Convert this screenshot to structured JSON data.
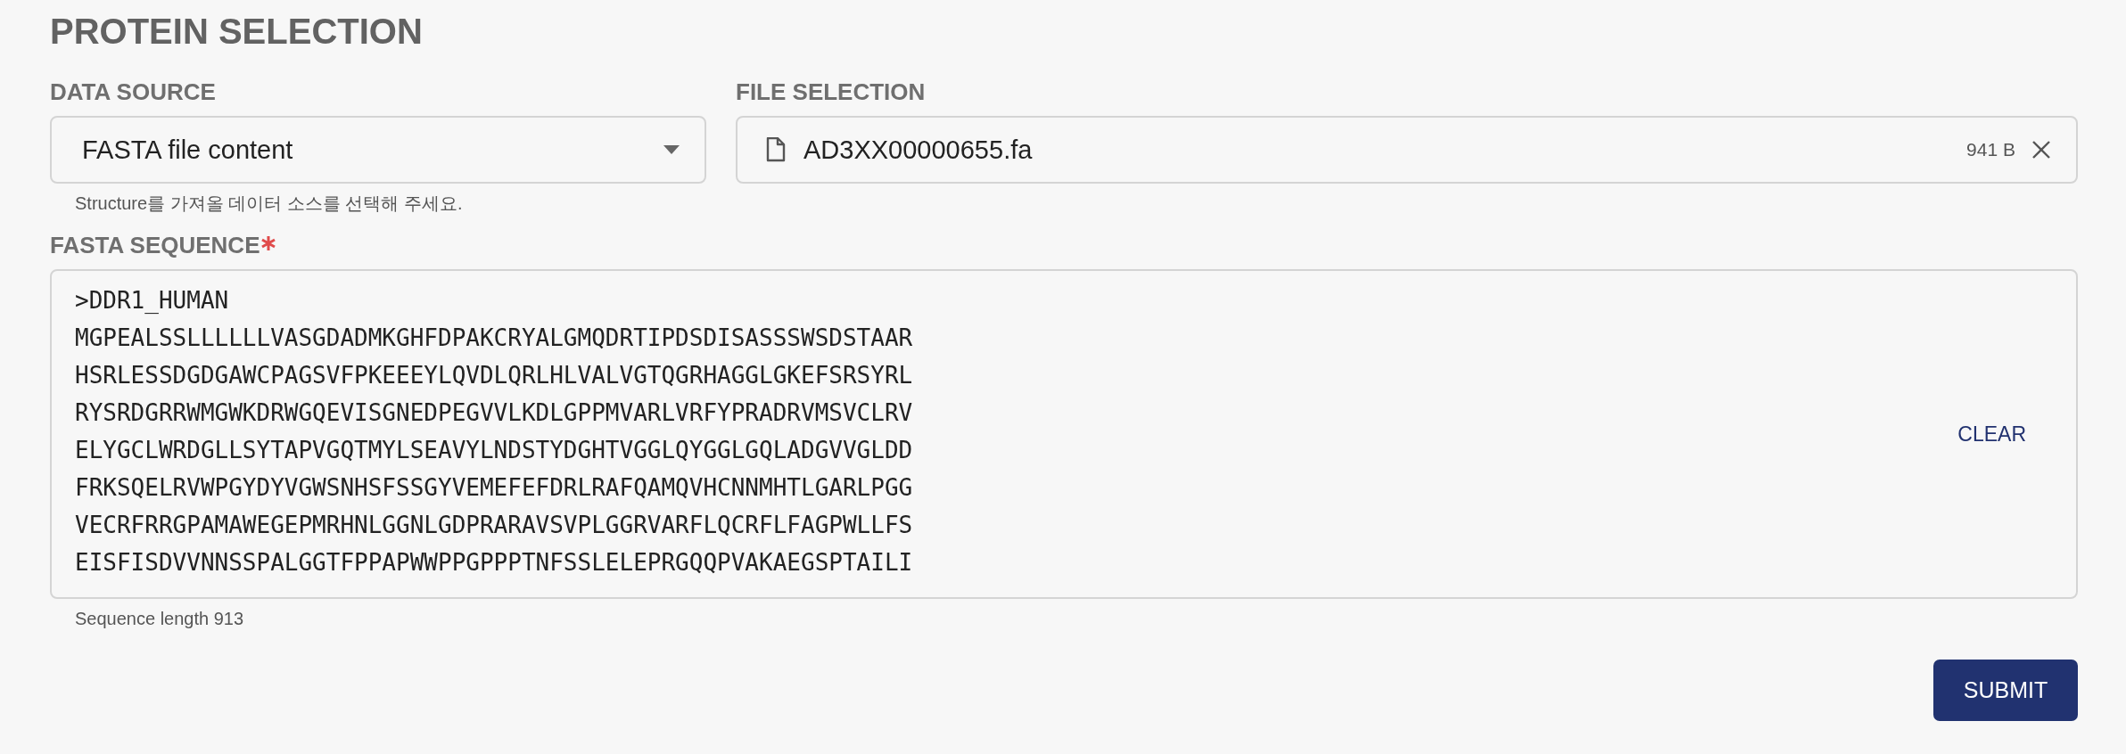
{
  "section_title": "PROTEIN SELECTION",
  "data_source": {
    "label": "DATA SOURCE",
    "value": "FASTA file content",
    "helper": "Structure를 가져올 데이터 소스를 선택해 주세요."
  },
  "file_selection": {
    "label": "FILE SELECTION",
    "file_name": "AD3XX00000655.fa",
    "file_size": "941 B"
  },
  "fasta_sequence": {
    "label": "FASTA SEQUENCE",
    "required": true,
    "lines": [
      ">DDR1_HUMAN",
      "MGPEALSSLLLLLLVASGDADMKGHFDPAKCRYALGMQDRTIPDSDISASSSWSDSTAAR",
      "HSRLESSDGDGAWCPAGSVFPKEEEYLQVDLQRLHLVALVGTQGRHAGGLGKEFSRSYRL",
      "RYSRDGRRWMGWKDRWGQEVISGNEDPEGVVLKDLGPPMVARLVRFYPRADRVMSVCLRV",
      "ELYGCLWRDGLLSYTAPVGQTMYLSEAVYLNDSTYDGHTVGGLQYGGLGQLADGVVGLDD",
      "FRKSQELRVWPGYDYVGWSNHSFSSGYVEMEFEFDRLRAFQAMQVHCNNMHTLGARLPGG",
      "VECRFRRGPAMAWEGEPMRHNLGGNLGDPRARAVSVPLGGRVARFLQCRFLFAGPWLLFS",
      "EISFISDVVNNSSPALGGTFPPAPWWPPGPPPTNFSSLELEPRGQQPVAKAEGSPTAILI"
    ],
    "clear_button": "CLEAR",
    "footer": "Sequence length 913"
  },
  "submit_button": "SUBMIT"
}
